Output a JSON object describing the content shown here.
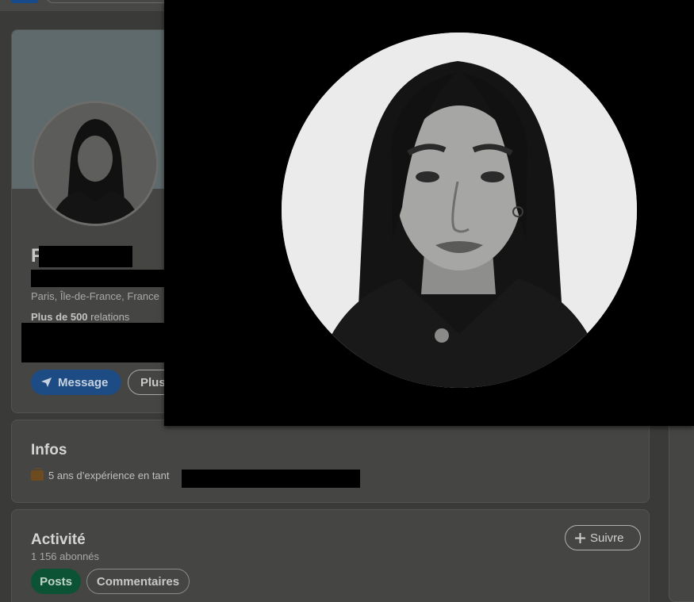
{
  "profile": {
    "name_initial": "F",
    "location": "Paris, Île-de-France, France",
    "relations_bold": "Plus de 500",
    "relations_rest": " relations",
    "message_button": "Message",
    "more_button": "Plus"
  },
  "infos": {
    "title": "Infos",
    "experience_prefix": "5 ans d’expérience en tant"
  },
  "activity": {
    "title": "Activité",
    "followers": "1 156 abonnés",
    "follow_button": "Suivre",
    "tabs": [
      {
        "label": "Posts"
      },
      {
        "label": "Commentaires"
      }
    ]
  }
}
